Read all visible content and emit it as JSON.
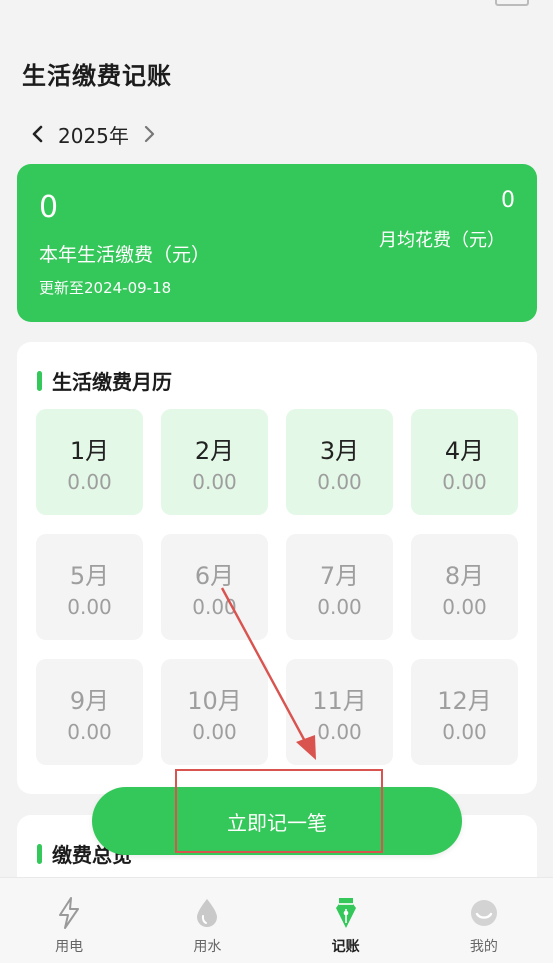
{
  "page": {
    "title": "生活缴费记账"
  },
  "year_nav": {
    "year": "2025年",
    "prev_icon": "chevron-left-icon",
    "next_icon": "chevron-right-icon"
  },
  "summary": {
    "total": "0",
    "total_label": "本年生活缴费（元）",
    "updated": "更新至2024-09-18",
    "avg": "0",
    "avg_label": "月均花费（元）"
  },
  "calendar": {
    "title": "生活缴费月历",
    "months": [
      {
        "label": "1月",
        "value": "0.00",
        "active": true
      },
      {
        "label": "2月",
        "value": "0.00",
        "active": true
      },
      {
        "label": "3月",
        "value": "0.00",
        "active": true
      },
      {
        "label": "4月",
        "value": "0.00",
        "active": true
      },
      {
        "label": "5月",
        "value": "0.00",
        "active": false
      },
      {
        "label": "6月",
        "value": "0.00",
        "active": false
      },
      {
        "label": "7月",
        "value": "0.00",
        "active": false
      },
      {
        "label": "8月",
        "value": "0.00",
        "active": false
      },
      {
        "label": "9月",
        "value": "0.00",
        "active": false
      },
      {
        "label": "10月",
        "value": "0.00",
        "active": false
      },
      {
        "label": "11月",
        "value": "0.00",
        "active": false
      },
      {
        "label": "12月",
        "value": "0.00",
        "active": false
      }
    ]
  },
  "overview": {
    "title": "缴费总览"
  },
  "record_button": {
    "label": "立即记一笔"
  },
  "nav": {
    "items": [
      {
        "label": "用电",
        "icon": "lightning-icon",
        "active": false
      },
      {
        "label": "用水",
        "icon": "water-drop-icon",
        "active": false
      },
      {
        "label": "记账",
        "icon": "pen-nib-icon",
        "active": true
      },
      {
        "label": "我的",
        "icon": "profile-icon",
        "active": false
      }
    ]
  },
  "colors": {
    "accent": "#34c759",
    "active_month_bg": "#e3f8e6",
    "annotation": "#d9534f"
  }
}
